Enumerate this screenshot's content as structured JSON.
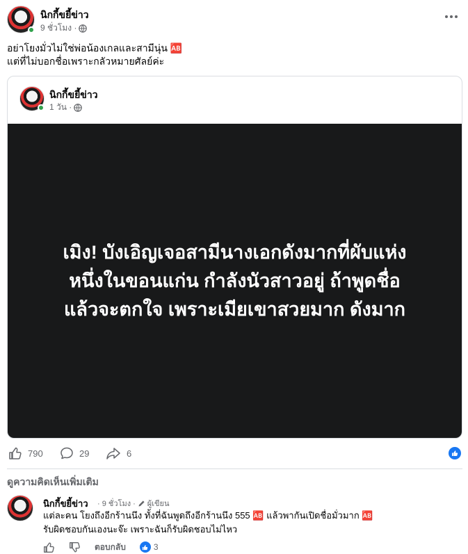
{
  "post": {
    "author": "นิกกี้ขยี้ข่าว",
    "time": "9 ชั่วโมง ·",
    "text_line1": "อย่าโยงมั่วไม่ใช่พ่อน้องเกลและสามีนุ่น 🆎",
    "text_line2": "แต่ที่ไม่บอกชื่อเพราะกลัวหมายศัลย์ค่ะ"
  },
  "shared": {
    "author": "นิกกี้ขยี้ข่าว",
    "time": "1 วัน ·",
    "image_text_line1": "เมิง! บังเอิญเจอสามีนางเอกดังมากที่ผับแห่ง",
    "image_text_line2": "หนึ่งในขอนแก่น กำลังนัวสาวอยู่ ถ้าพูดชื่อ",
    "image_text_line3": "แล้วจะตกใจ เพราะเมียเขาสวยมาก ดังมาก"
  },
  "stats": {
    "likes": "790",
    "comments": "29",
    "shares": "6"
  },
  "view_more_comments": "ดูความคิดเห็นเพิ่มเติม",
  "comment": {
    "author": "นิกกี้ขยี้ข่าว",
    "time": "· 9 ชั่วโมง ·",
    "badge": "ผู้เขียน",
    "text_line1": "แต่ละคน โยงถึงอีกร้านนึง ทั้งที่ฉันพูดถึงอีกร้านนึง 555 🆎 แล้วพากันเปิดชื่อมั่วมาก 🆎",
    "text_line2": "รับผิดชอบกันเองนะจ๊ะ เพราะฉันก็รับผิดชอบไม่ไหว",
    "reply_label": "ตอบกลับ",
    "reaction_count": "3"
  },
  "colors": {
    "accent": "#1877f2",
    "online": "#31a24c",
    "image_bg": "#18191a",
    "muted_text": "#65676b"
  },
  "icons": [
    "globe-icon",
    "more-icon",
    "like-icon",
    "comment-icon",
    "share-icon",
    "like-badge-icon",
    "pencil-icon",
    "dislike-icon"
  ]
}
